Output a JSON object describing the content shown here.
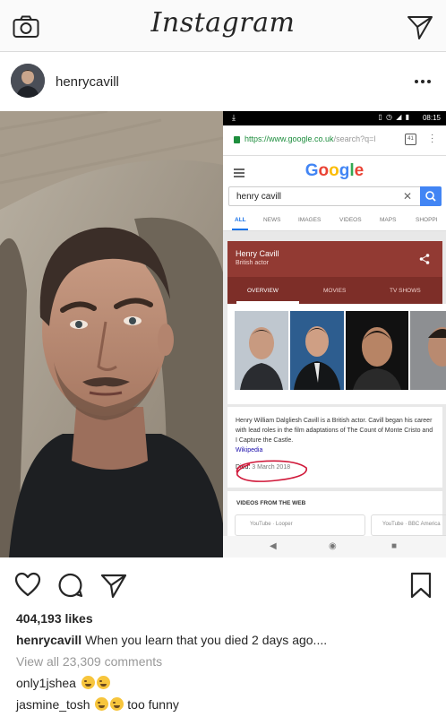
{
  "topbar": {
    "logo": "Instagram"
  },
  "post": {
    "username": "henrycavill",
    "likes": "404,193 likes",
    "caption_user": "henrycavill",
    "caption_text": "When you learn that you died 2 days ago....",
    "view_all": "View all 23,309 comments",
    "comments": [
      {
        "user": "only1jshea",
        "text": ""
      },
      {
        "user": "jasmine_tosh",
        "text": "too funny"
      }
    ]
  },
  "phone": {
    "time": "08:15",
    "url_main": "https://www.google.co.uk",
    "url_rest": "/search?q=l",
    "tab_count": "41",
    "query": "henry cavill",
    "search_tabs": [
      "ALL",
      "NEWS",
      "IMAGES",
      "VIDEOS",
      "MAPS",
      "SHOPPI"
    ],
    "kp_name": "Henry Cavill",
    "kp_role": "British actor",
    "kp_tabs": [
      "OVERVIEW",
      "MOVIES",
      "TV SHOWS"
    ],
    "description": "Henry William Dalgliesh Cavill is a British actor. Cavill began his career with lead roles in the film adaptations of The Count of Monte Cristo and I Capture the Castle.",
    "wiki_link": "Wikipedia",
    "died_label": "Died:",
    "died_value": "3 March 2018",
    "videos_title": "VIDEOS FROM THE WEB",
    "video1": "YouTube · Looper",
    "video2": "YouTube · BBC America"
  },
  "colors": {
    "kp_red": "#923a33",
    "google_blue": "#4285f4",
    "annotation_red": "#d0193a"
  }
}
